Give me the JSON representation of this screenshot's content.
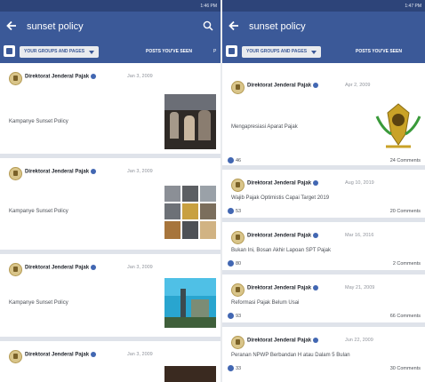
{
  "left": {
    "status": {
      "left": "",
      "right": "1:46 PM"
    },
    "search": {
      "query": "sunset policy"
    },
    "filters": {
      "chip1": "YOUR GROUPS AND PAGES",
      "chip2": "POSTS YOU'VE SEEN",
      "chip3": "P"
    },
    "posts": [
      {
        "author": "Direktorat Jenderal Pajak",
        "date": "Jan 3, 2009",
        "body": "Kampanye Sunset Policy"
      },
      {
        "author": "Direktorat Jenderal Pajak",
        "date": "Jan 3, 2009",
        "body": "Kampanye Sunset Policy"
      },
      {
        "author": "Direktorat Jenderal Pajak",
        "date": "Jan 3, 2009",
        "body": "Kampanye Sunset Policy"
      },
      {
        "author": "Direktorat Jenderal Pajak",
        "date": "Jan 3, 2009",
        "body": ""
      }
    ]
  },
  "right": {
    "status": {
      "left": "",
      "right": "1:47 PM"
    },
    "search": {
      "query": "sunset policy"
    },
    "filters": {
      "chip1": "YOUR GROUPS AND PAGES",
      "chip2": "POSTS YOU'VE SEEN"
    },
    "posts": [
      {
        "author": "Direktorat Jenderal Pajak",
        "date": "Apr 2, 2009",
        "body": "Mengapresiasi Aparat Pajak",
        "reactions": "46",
        "comments": "24 Comments"
      },
      {
        "author": "Direktorat Jenderal Pajak",
        "date": "Aug 10, 2019",
        "body": "Wajib Pajak Optimistis Capai Target 2019",
        "reactions": "53",
        "comments": "20 Comments"
      },
      {
        "author": "Direktorat Jenderal Pajak",
        "date": "Mar 16, 2016",
        "body": "Bukan Ini, Bosan Akhir Lapoan SPT Pajak",
        "reactions": "80",
        "comments": "2 Comments"
      },
      {
        "author": "Direktorat Jenderal Pajak",
        "date": "May 21, 2009",
        "body": "Reformasi Pajak Belum Usai",
        "reactions": "93",
        "comments": "66 Comments"
      },
      {
        "author": "Direktorat Jenderal Pajak",
        "date": "Jun 22, 2009",
        "body": "Peranan NPWP Berbandan H atau Dalam 5 Bulan",
        "reactions": "33",
        "comments": "30 Comments"
      }
    ]
  },
  "icons": {
    "back": "arrow-left-icon",
    "search": "search-icon",
    "verified": "verified-badge-icon",
    "globe": "globe-icon",
    "like": "like-reaction-icon",
    "avatar": "dgp-logo-icon"
  },
  "colors": {
    "header": "#3b5998",
    "statusbar": "#2d4479",
    "accent": "#4267b2",
    "background": "#e9ebee"
  }
}
